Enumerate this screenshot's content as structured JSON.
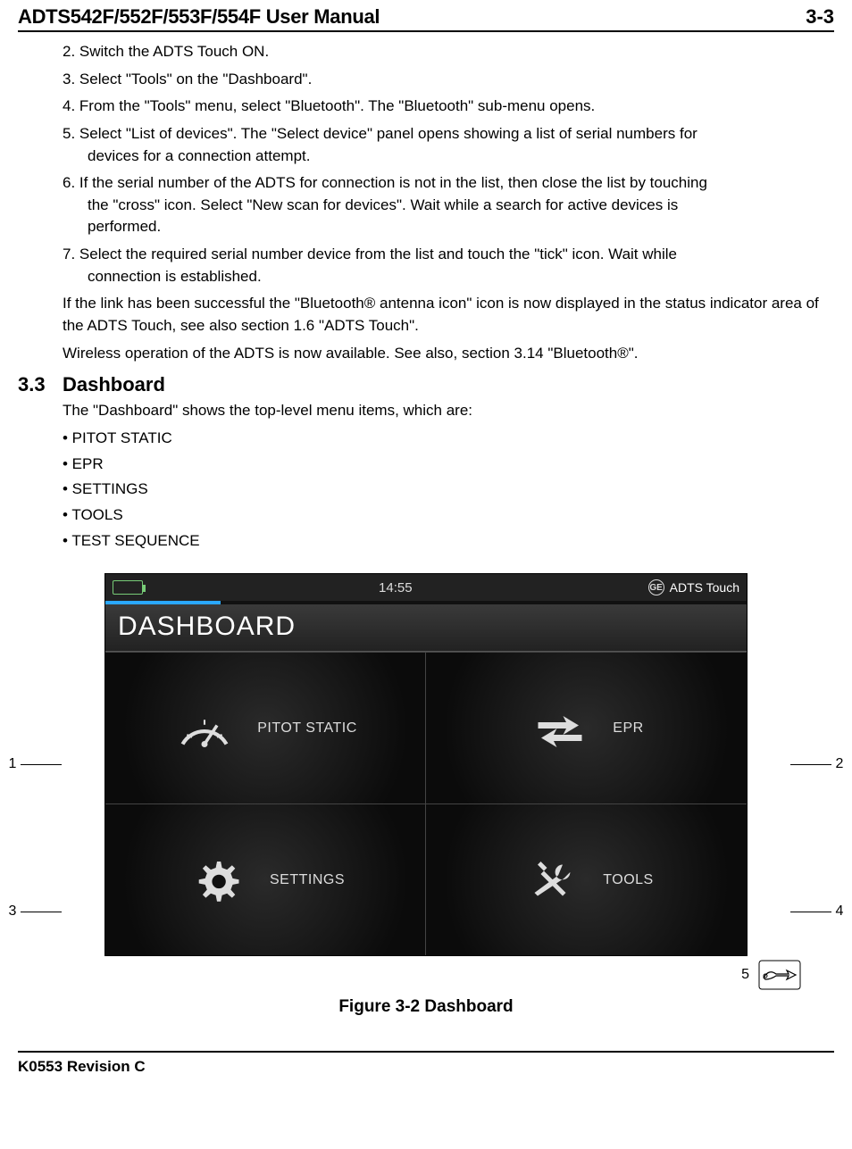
{
  "header": {
    "title": "ADTS542F/552F/553F/554F User Manual",
    "page_label": "3-3"
  },
  "steps": {
    "s2": "2. Switch the ADTS Touch ON.",
    "s3": "3. Select \"Tools\" on the \"Dashboard\".",
    "s4": "4. From the \"Tools\" menu, select \"Bluetooth\". The \"Bluetooth\" sub-menu opens.",
    "s5a": "5. Select \"List of devices\". The \"Select device\" panel opens showing a list of serial numbers for",
    "s5b": "devices for a connection attempt.",
    "s6a": "6. If the serial number of the ADTS for connection is not in the list, then close the list by touching",
    "s6b": "the \"cross\" icon. Select \"New scan for devices\". Wait while a search for active devices is",
    "s6c": "performed.",
    "s7a": "7. Select the required serial number device from the list and touch the \"tick\" icon. Wait while",
    "s7b": "connection is established.",
    "p1": "If the link has been successful the \"Bluetooth® antenna icon\" icon is now displayed in the status indicator area of the ADTS Touch, see also section 1.6 \"ADTS Touch\".",
    "p2": "Wireless operation of the ADTS is now available. See also, section 3.14 \"Bluetooth®\"."
  },
  "section": {
    "num": "3.3",
    "title": "Dashboard",
    "intro": "The \"Dashboard\" shows the top-level menu items, which are:",
    "bullets": {
      "b1": "• PITOT STATIC",
      "b2": "• EPR",
      "b3": "• SETTINGS",
      "b4": "• TOOLS",
      "b5": "• TEST SEQUENCE"
    }
  },
  "figure": {
    "callouts": {
      "c1": "1",
      "c2": "2",
      "c3": "3",
      "c4": "4",
      "c5": "5"
    },
    "statusbar": {
      "time": "14:55",
      "product": "ADTS Touch"
    },
    "dashboard_title": "DASHBOARD",
    "tiles": {
      "pitot": "PITOT STATIC",
      "epr": "EPR",
      "settings": "SETTINGS",
      "tools": "TOOLS"
    },
    "caption": "Figure 3-2 Dashboard"
  },
  "footer": {
    "revision": "K0553 Revision C"
  }
}
